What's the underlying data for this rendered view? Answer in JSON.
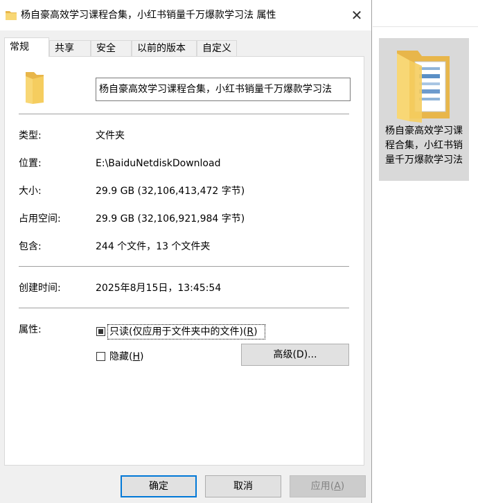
{
  "window": {
    "title": "杨自豪高效学习课程合集，小红书销量千万爆款学习法 属性",
    "close_glyph": "✕"
  },
  "tabs": [
    {
      "label": "常规",
      "active": true
    },
    {
      "label": "共享",
      "active": false
    },
    {
      "label": "安全",
      "active": false
    },
    {
      "label": "以前的版本",
      "active": false
    },
    {
      "label": "自定义",
      "active": false
    }
  ],
  "general": {
    "name_value": "杨自豪高效学习课程合集，小红书销量千万爆款学习法",
    "type_label": "类型:",
    "type_value": "文件夹",
    "location_label": "位置:",
    "location_value": "E:\\BaiduNetdiskDownload",
    "size_label": "大小:",
    "size_value": "29.9 GB (32,106,413,472 字节)",
    "disk_size_label": "占用空间:",
    "disk_size_value": "29.9 GB (32,106,921,984 字节)",
    "contains_label": "包含:",
    "contains_value": "244 个文件，13 个文件夹",
    "created_label": "创建时间:",
    "created_value": "2025年8月15日，13:45:54",
    "attributes_label": "属性:",
    "readonly": {
      "label_prefix": "只读(仅应用于文件夹中的文件)(",
      "hotkey": "R",
      "label_suffix": ")",
      "state": "indeterminate"
    },
    "hidden": {
      "label_prefix": "隐藏(",
      "hotkey": "H",
      "label_suffix": ")",
      "state": "unchecked"
    },
    "advanced_button": "高级(D)..."
  },
  "footer": {
    "ok_label": "确定",
    "cancel_label": "取消",
    "apply_prefix": "应用(",
    "apply_hotkey": "A",
    "apply_suffix": ")"
  },
  "explorer": {
    "item_label": "杨自豪高效学习课程合集，小红书销量千万爆款学习法"
  },
  "icons": {
    "title_icon": "folder-icon",
    "small_folder": "folder-icon",
    "large_folder": "folder-with-documents-icon"
  },
  "colors": {
    "folder_yellow": "#f8d775",
    "folder_dark": "#e8b64a",
    "accent": "#0078d7",
    "selection_gray": "#d9d9d9"
  }
}
